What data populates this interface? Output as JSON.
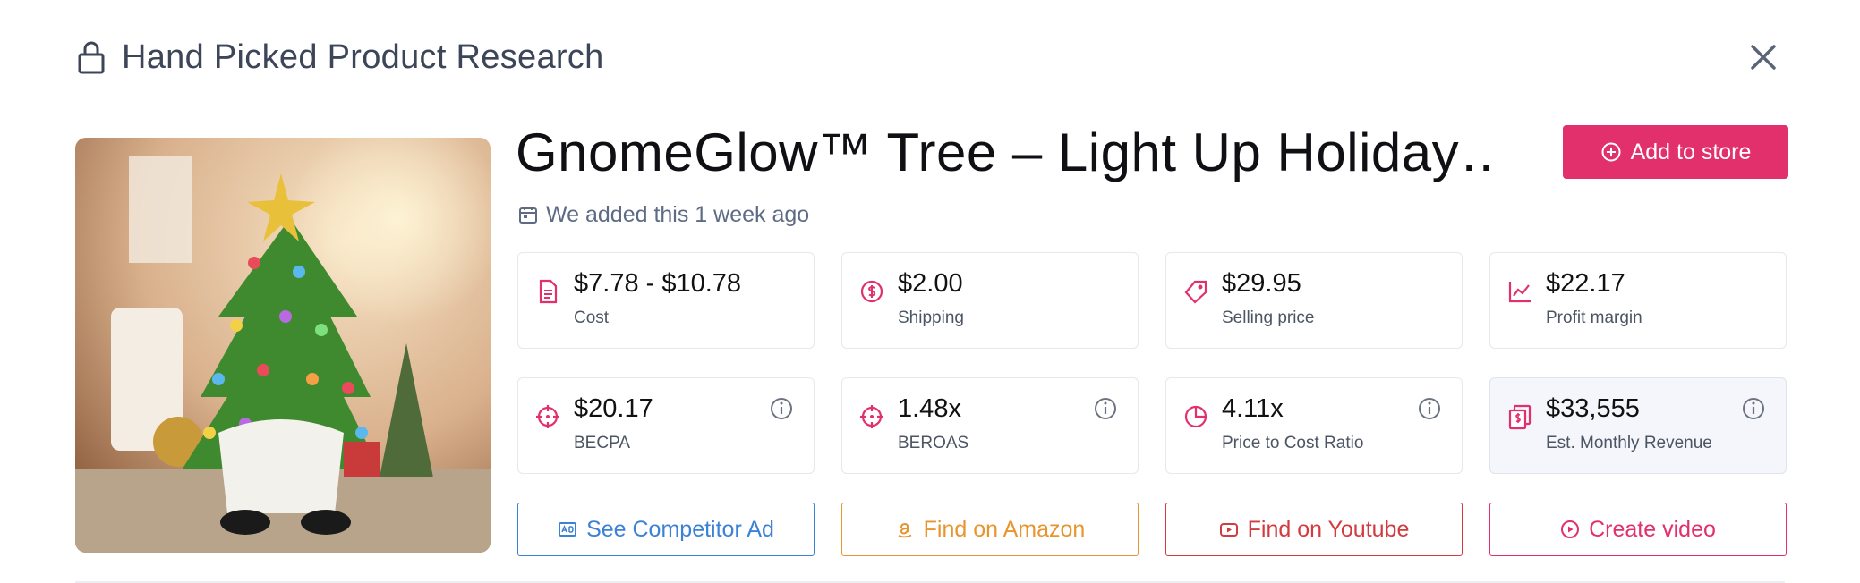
{
  "header": {
    "title": "Hand Picked Product Research",
    "icon": "lock-icon"
  },
  "product": {
    "title": "GnomeGlow™ Tree – Light Up Holiday…",
    "added_text": "We added this 1 week ago",
    "image_alt": "ceramic-christmas-tree-gnome"
  },
  "actions": {
    "add_to_store": "Add to store"
  },
  "colors": {
    "accent": "#e2306c",
    "blue": "#3b82d6",
    "orange": "#e8952f",
    "red": "#d23b40",
    "pink": "#e2306c"
  },
  "metrics": [
    {
      "value": "$7.78 - $10.78",
      "label": "Cost",
      "icon": "document-icon"
    },
    {
      "value": "$2.00",
      "label": "Shipping",
      "icon": "coins-icon"
    },
    {
      "value": "$29.95",
      "label": "Selling price",
      "icon": "tag-icon"
    },
    {
      "value": "$22.17",
      "label": "Profit margin",
      "icon": "trend-chart-icon"
    },
    {
      "value": "$20.17",
      "label": "BECPA",
      "icon": "crosshair-icon"
    },
    {
      "value": "1.48x",
      "label": "BEROAS",
      "icon": "crosshair-icon"
    },
    {
      "value": "4.11x",
      "label": "Price to Cost Ratio",
      "icon": "pie-chart-icon"
    },
    {
      "value": "$33,555",
      "label": "Est. Monthly Revenue",
      "icon": "revenue-icon"
    }
  ],
  "links": [
    {
      "label": "See Competitor Ad",
      "icon": "ad-icon"
    },
    {
      "label": "Find on Amazon",
      "icon": "amazon-icon"
    },
    {
      "label": "Find on Youtube",
      "icon": "youtube-icon"
    },
    {
      "label": "Create video",
      "icon": "play-circle-icon"
    }
  ]
}
